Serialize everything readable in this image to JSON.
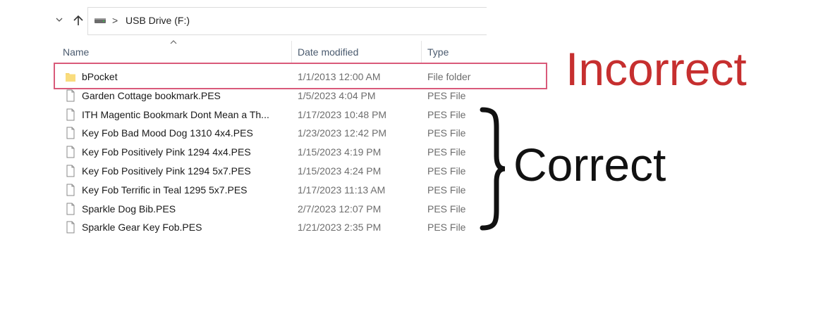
{
  "address": {
    "path_separator": ">",
    "path_label": "USB Drive (F:)"
  },
  "columns": {
    "name": "Name",
    "date_modified": "Date modified",
    "type": "Type"
  },
  "files": [
    {
      "name": "bPocket",
      "date": "1/1/2013 12:00 AM",
      "type": "File folder",
      "icon": "folder-icon"
    },
    {
      "name": "Garden Cottage bookmark.PES",
      "date": "1/5/2023 4:04 PM",
      "type": "PES File",
      "icon": "file-icon"
    },
    {
      "name": "ITH Magentic Bookmark Dont Mean a Th...",
      "date": "1/17/2023 10:48 PM",
      "type": "PES File",
      "icon": "file-icon"
    },
    {
      "name": "Key Fob Bad Mood Dog 1310 4x4.PES",
      "date": "1/23/2023 12:42 PM",
      "type": "PES File",
      "icon": "file-icon"
    },
    {
      "name": "Key Fob Positively Pink 1294 4x4.PES",
      "date": "1/15/2023 4:19 PM",
      "type": "PES File",
      "icon": "file-icon"
    },
    {
      "name": "Key Fob Positively Pink 1294 5x7.PES",
      "date": "1/15/2023 4:24 PM",
      "type": "PES File",
      "icon": "file-icon"
    },
    {
      "name": "Key Fob Terrific in Teal 1295 5x7.PES",
      "date": "1/17/2023 11:13 AM",
      "type": "PES File",
      "icon": "file-icon"
    },
    {
      "name": "Sparkle Dog Bib.PES",
      "date": "2/7/2023 12:07 PM",
      "type": "PES File",
      "icon": "file-icon"
    },
    {
      "name": "Sparkle Gear Key Fob.PES",
      "date": "1/21/2023 2:35 PM",
      "type": "PES File",
      "icon": "file-icon"
    }
  ],
  "annotations": {
    "incorrect": "Incorrect",
    "correct": "Correct",
    "incorrect_color": "#c62f2f",
    "highlight_color": "#d95a7a",
    "correct_color": "#111111"
  }
}
